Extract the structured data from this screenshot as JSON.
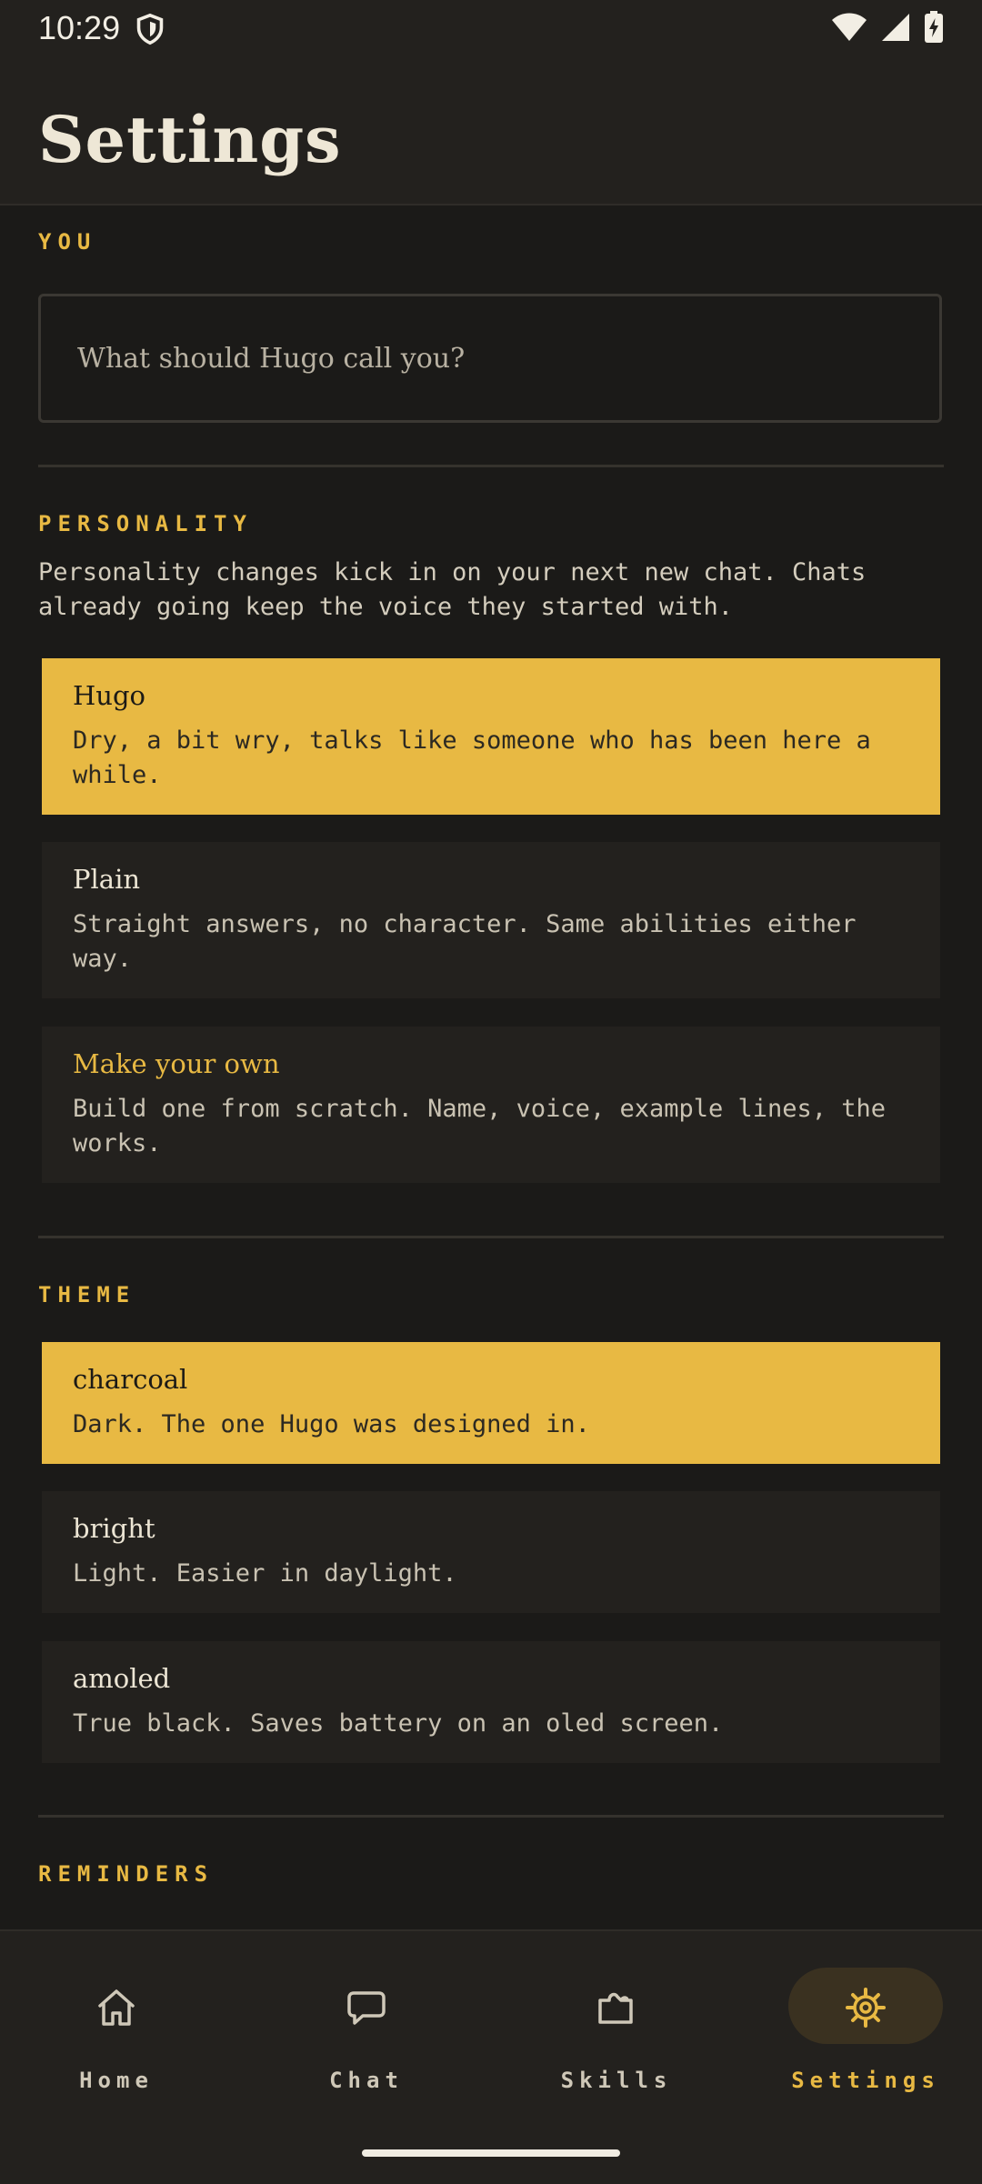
{
  "status_bar": {
    "time": "10:29"
  },
  "header": {
    "title": "Settings"
  },
  "you": {
    "section_label": "YOU",
    "name_input": {
      "placeholder": "What should Hugo call you?",
      "value": ""
    }
  },
  "personality": {
    "section_label": "PERSONALITY",
    "description": "Personality changes kick in on your next new chat. Chats already going keep the voice they started with.",
    "options": [
      {
        "title": "Hugo",
        "description": "Dry, a bit wry, talks like someone who has been here a while.",
        "selected": true
      },
      {
        "title": "Plain",
        "description": "Straight answers, no character. Same abilities either way.",
        "selected": false
      },
      {
        "title": "Make your own",
        "description": "Build one from scratch. Name, voice, example lines, the works.",
        "selected": false
      }
    ]
  },
  "theme": {
    "section_label": "THEME",
    "options": [
      {
        "title": "charcoal",
        "description": "Dark. The one Hugo was designed in.",
        "selected": true
      },
      {
        "title": "bright",
        "description": "Light. Easier in daylight.",
        "selected": false
      },
      {
        "title": "amoled",
        "description": "True black. Saves battery on an oled screen.",
        "selected": false
      }
    ]
  },
  "reminders": {
    "section_label": "REMINDERS"
  },
  "bottom_nav": {
    "items": [
      {
        "label": "Home",
        "icon": "home-icon",
        "active": false
      },
      {
        "label": "Chat",
        "icon": "chat-icon",
        "active": false
      },
      {
        "label": "Skills",
        "icon": "puzzle-icon",
        "active": false
      },
      {
        "label": "Settings",
        "icon": "gear-icon",
        "active": true
      }
    ]
  },
  "colors": {
    "background": "#1b1a18",
    "surface": "#23211e",
    "accent": "#e8b943",
    "text": "#e9e4d8"
  }
}
